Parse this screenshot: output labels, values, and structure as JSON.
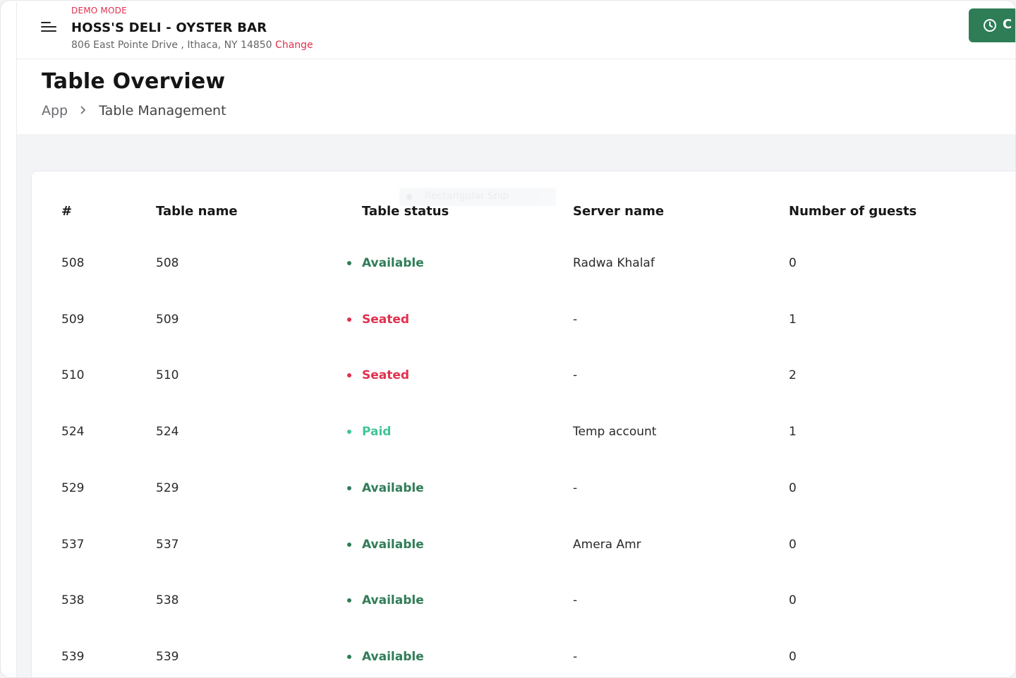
{
  "topbar": {
    "mode": "DEMO MODE",
    "restaurant_name": "HOSS'S DELI - OYSTER BAR",
    "address": "806 East Pointe Drive , Ithaca, NY 14850",
    "change_label": "Change",
    "action_label": "C",
    "action_icon": "clock-icon",
    "menu_icon": "hamburger-menu-icon",
    "accent_color": "#2f7d57",
    "alert_color": "#e0304e"
  },
  "page": {
    "title": "Table Overview",
    "breadcrumb": {
      "home": "App",
      "separator_icon": "chevron-right-icon",
      "current": "Table Management"
    }
  },
  "ghost_overlay": {
    "text": "Rectangular Snip"
  },
  "table": {
    "columns": [
      "#",
      "Table name",
      "Table status",
      "Server name",
      "Number of guests"
    ],
    "status_colors": {
      "Available": "#2f7d57",
      "Seated": "#e0304e",
      "Paid": "#43c49a"
    },
    "rows": [
      {
        "num": "508",
        "name": "508",
        "status": "Available",
        "status_key": "available",
        "server": "Radwa Khalaf",
        "guests": "0"
      },
      {
        "num": "509",
        "name": "509",
        "status": "Seated",
        "status_key": "seated",
        "server": "-",
        "guests": "1"
      },
      {
        "num": "510",
        "name": "510",
        "status": "Seated",
        "status_key": "seated",
        "server": "-",
        "guests": "2"
      },
      {
        "num": "524",
        "name": "524",
        "status": "Paid",
        "status_key": "paid",
        "server": "Temp account",
        "guests": "1"
      },
      {
        "num": "529",
        "name": "529",
        "status": "Available",
        "status_key": "available",
        "server": "-",
        "guests": "0"
      },
      {
        "num": "537",
        "name": "537",
        "status": "Available",
        "status_key": "available",
        "server": "Amera Amr",
        "guests": "0"
      },
      {
        "num": "538",
        "name": "538",
        "status": "Available",
        "status_key": "available",
        "server": "-",
        "guests": "0"
      },
      {
        "num": "539",
        "name": "539",
        "status": "Available",
        "status_key": "available",
        "server": "-",
        "guests": "0"
      }
    ]
  }
}
